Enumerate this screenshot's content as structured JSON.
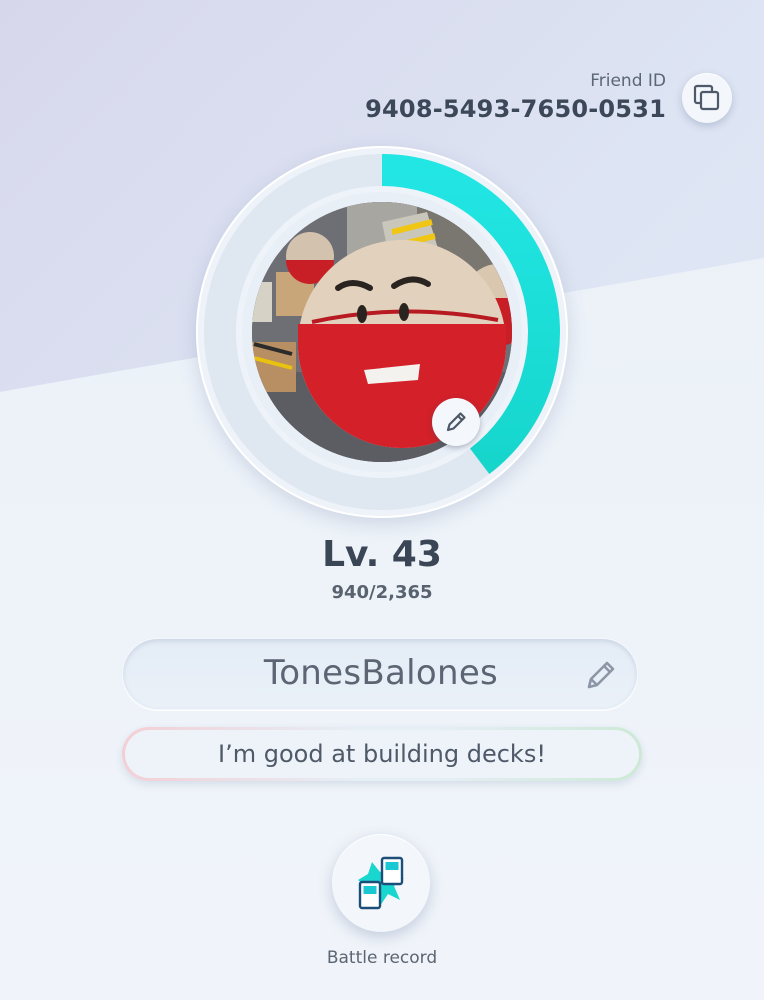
{
  "friend": {
    "label": "Friend ID",
    "id": "9408-5493-7650-0531",
    "copy_icon": "copy-icon"
  },
  "profile": {
    "level_text": "Lv. 43",
    "xp_text": "940/2,365",
    "xp_progress_fraction": 0.397,
    "ring_color": "#1ee0dc",
    "avatar_icon": "edit-pencil-icon"
  },
  "name_field": {
    "value": "TonesBalones",
    "edit_icon": "edit-pencil-icon"
  },
  "bio": {
    "text": "I’m good at building decks!"
  },
  "battle_record": {
    "label": "Battle record",
    "icon": "battle-cards-icon"
  }
}
